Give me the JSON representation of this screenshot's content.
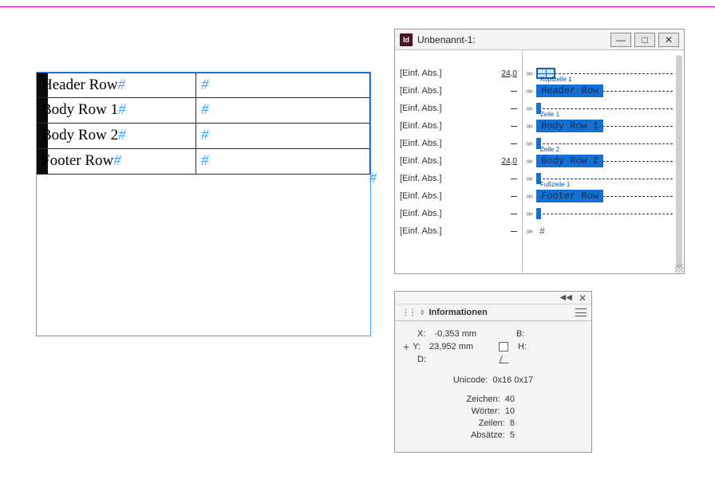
{
  "table": {
    "rows": [
      {
        "label": "Header Row",
        "hash": "#"
      },
      {
        "label": "Body Row 1",
        "hash": "#"
      },
      {
        "label": "Body Row 2",
        "hash": "#"
      },
      {
        "label": "Footer Row",
        "hash": "#"
      }
    ],
    "endmark": "#"
  },
  "story": {
    "title": "Unbenannt-1:",
    "app_abbrev": "Id",
    "para_style": "[Einf. Abs.]",
    "measure": "24,0",
    "entries": [
      {
        "kind": "table"
      },
      {
        "kind": "text",
        "label": "Kopfzeile 1",
        "text": "Header Row"
      },
      {
        "kind": "tick"
      },
      {
        "kind": "text",
        "label": "Zeile 1",
        "text": "Body Row 1"
      },
      {
        "kind": "tick"
      },
      {
        "kind": "text",
        "label": "Zeile 2",
        "text": "Body Row 2"
      },
      {
        "kind": "tick"
      },
      {
        "kind": "text",
        "label": "Fußzeile 1",
        "text": "Footer Row"
      },
      {
        "kind": "tick"
      },
      {
        "kind": "hash"
      }
    ]
  },
  "info": {
    "title": "Informationen",
    "x_label": "X:",
    "x_value": "-0,353 mm",
    "y_label": "Y:",
    "y_value": "23,952 mm",
    "d_label": "D:",
    "b_label": "B:",
    "h_label": "H:",
    "unicode_label": "Unicode:",
    "unicode_value": "0x16 0x17",
    "stats": {
      "chars_label": "Zeichen:",
      "chars": "40",
      "words_label": "Wörter:",
      "words": "10",
      "lines_label": "Zeilen:",
      "lines": "8",
      "paras_label": "Absätze:",
      "paras": "5"
    }
  }
}
